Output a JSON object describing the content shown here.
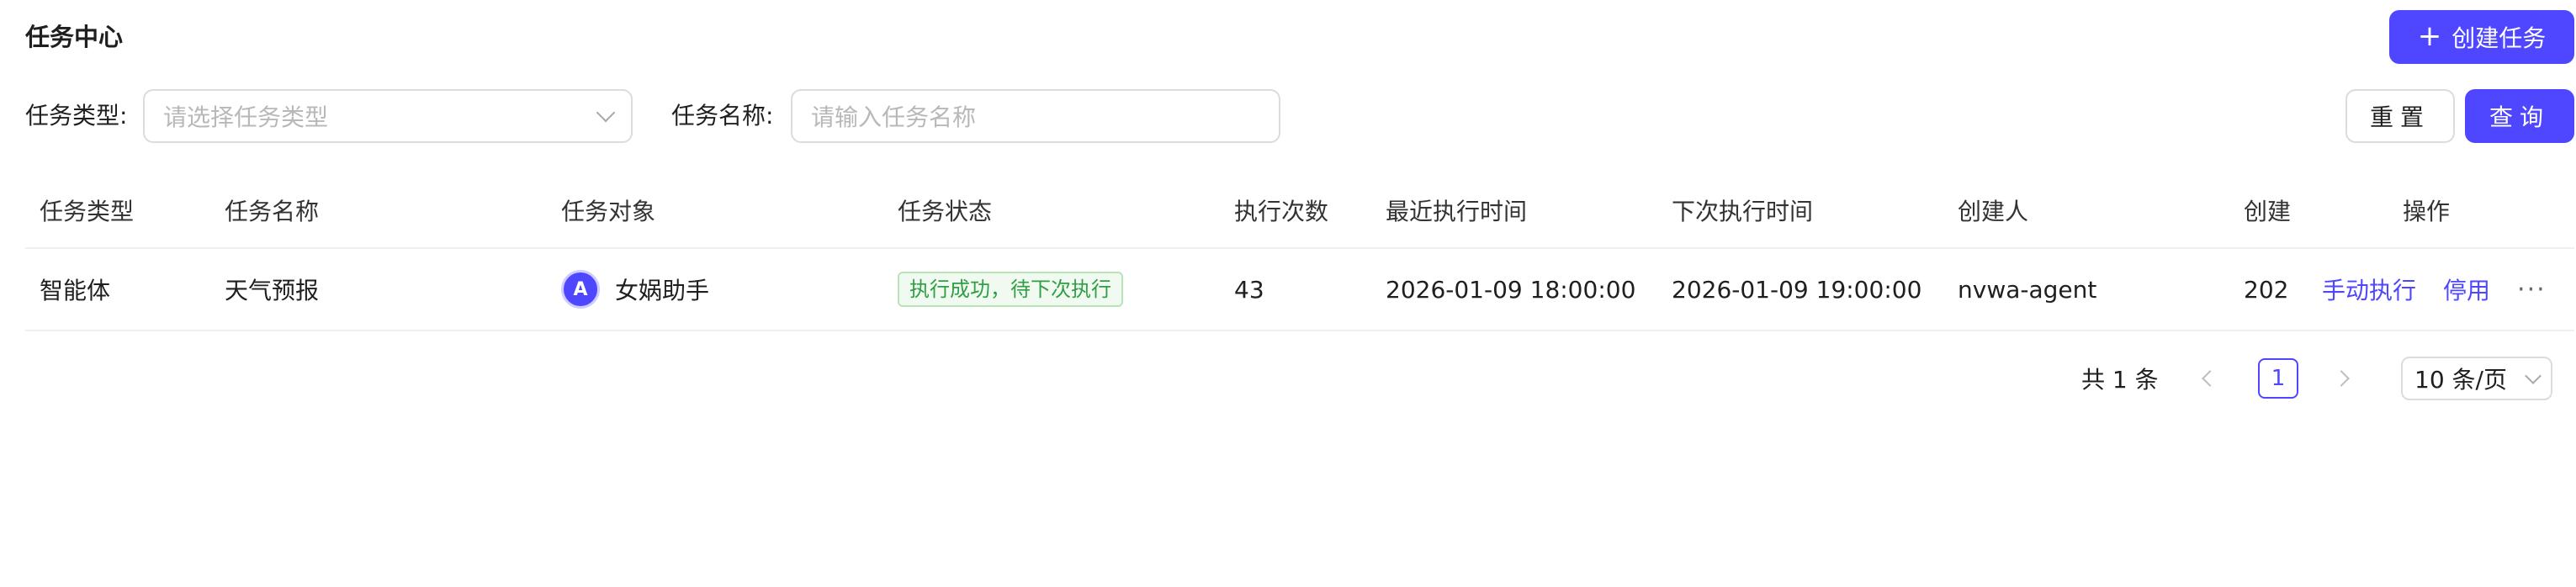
{
  "page": {
    "title": "任务中心",
    "create_button": "创建任务"
  },
  "filters": {
    "type_label": "任务类型:",
    "type_placeholder": "请选择任务类型",
    "name_label": "任务名称:",
    "name_placeholder": "请输入任务名称",
    "reset_button": "重置",
    "query_button": "查询"
  },
  "table": {
    "columns": [
      "任务类型",
      "任务名称",
      "任务对象",
      "任务状态",
      "执行次数",
      "最近执行时间",
      "下次执行时间",
      "创建人",
      "创建",
      "操作"
    ],
    "rows": [
      {
        "type": "智能体",
        "name": "天气预报",
        "target_avatar": "A",
        "target": "女娲助手",
        "status": "执行成功，待下次执行",
        "count": "43",
        "last_time": "2026-01-09 18:00:00",
        "next_time": "2026-01-09 19:00:00",
        "creator": "nvwa-agent",
        "created": "202",
        "action_run": "手动执行",
        "action_disable": "停用",
        "action_more": "···"
      }
    ]
  },
  "pagination": {
    "total": "共 1 条",
    "current_page": "1",
    "page_size": "10 条/页"
  },
  "colors": {
    "primary": "#4f46ff",
    "success_text": "#2f9e44",
    "success_bg": "#f0faf0"
  },
  "icons": {
    "create": "plus-icon",
    "select": "chevron-down-icon",
    "prev": "chevron-left-icon",
    "next": "chevron-right-icon",
    "more": "more-icon"
  }
}
